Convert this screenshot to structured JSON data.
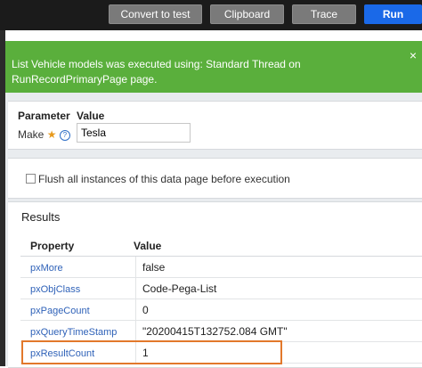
{
  "toolbar": {
    "convert_label": "Convert to test",
    "clipboard_label": "Clipboard",
    "trace_label": "Trace",
    "run_label": "Run"
  },
  "notice": {
    "message": "List Vehicle models was executed using: Standard Thread on RunRecordPrimaryPage page.",
    "close_glyph": "×"
  },
  "parameters": {
    "header_parameter": "Parameter",
    "header_value": "Value",
    "param_name": "Make",
    "required_marker": "★",
    "help_glyph": "?",
    "param_value": "Tesla"
  },
  "flush": {
    "label": "Flush all instances of this data page before execution",
    "checked": false
  },
  "results": {
    "title": "Results",
    "columns": [
      "Property",
      "Value"
    ],
    "rows": [
      {
        "property": "pxMore",
        "value": "false"
      },
      {
        "property": "pxObjClass",
        "value": "Code-Pega-List"
      },
      {
        "property": "pxPageCount",
        "value": "0"
      },
      {
        "property": "pxQueryTimeStamp",
        "value": "\"20200415T132752.084 GMT\""
      },
      {
        "property": "pxResultCount",
        "value": "1"
      }
    ]
  },
  "colors": {
    "notice_bg": "#5aaf3c",
    "run_button": "#1a69e8",
    "highlight_border": "#e2782b",
    "link": "#2f62b8"
  }
}
